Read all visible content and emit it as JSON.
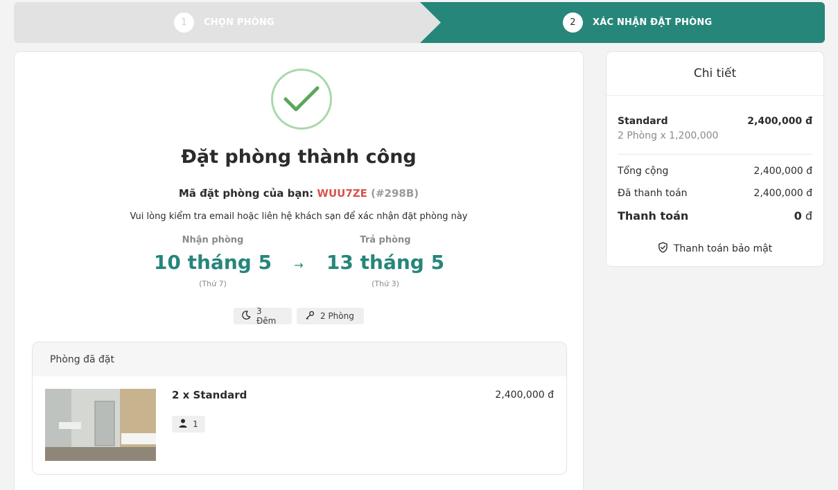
{
  "stepper": {
    "steps": [
      {
        "number": "1",
        "label": "CHỌN PHÒNG"
      },
      {
        "number": "2",
        "label": "XÁC NHẬN ĐẶT PHÒNG"
      }
    ],
    "active_color": "#26867a"
  },
  "confirmation": {
    "title": "Đặt phòng thành công",
    "code_label": "Mã đặt phòng của bạn:",
    "code": "WUU7ZE",
    "code_id": "(#298B)",
    "note": "Vui lòng kiểm tra email hoặc liên hệ khách sạn để xác nhận đặt phòng này",
    "checkin": {
      "label": "Nhận phòng",
      "date": "10 tháng 5",
      "weekday": "(Thứ 7)"
    },
    "arrow": "→",
    "checkout": {
      "label": "Trả phòng",
      "date": "13 tháng 5",
      "weekday": "(Thứ 3)"
    },
    "nights": "3 Đêm",
    "rooms": "2 Phòng"
  },
  "booked_rooms": {
    "header": "Phòng đã đặt",
    "items": [
      {
        "name": "2 x Standard",
        "price": "2,400,000 đ",
        "guests": "1"
      }
    ]
  },
  "details": {
    "title": "Chi tiết",
    "room_type": "Standard",
    "room_amount": "2,400,000 đ",
    "room_calc": "2 Phòng x 1,200,000",
    "total_label": "Tổng cộng",
    "total_value": "2,400,000 đ",
    "paid_label": "Đã thanh toán",
    "paid_value": "2,400,000 đ",
    "due_label": "Thanh toán",
    "due_amount": "0",
    "due_currency": "đ",
    "secure_label": "Thanh toán bảo mật"
  },
  "colors": {
    "accent": "#26867a",
    "code": "#d9534f",
    "success": "#5aa85a"
  }
}
